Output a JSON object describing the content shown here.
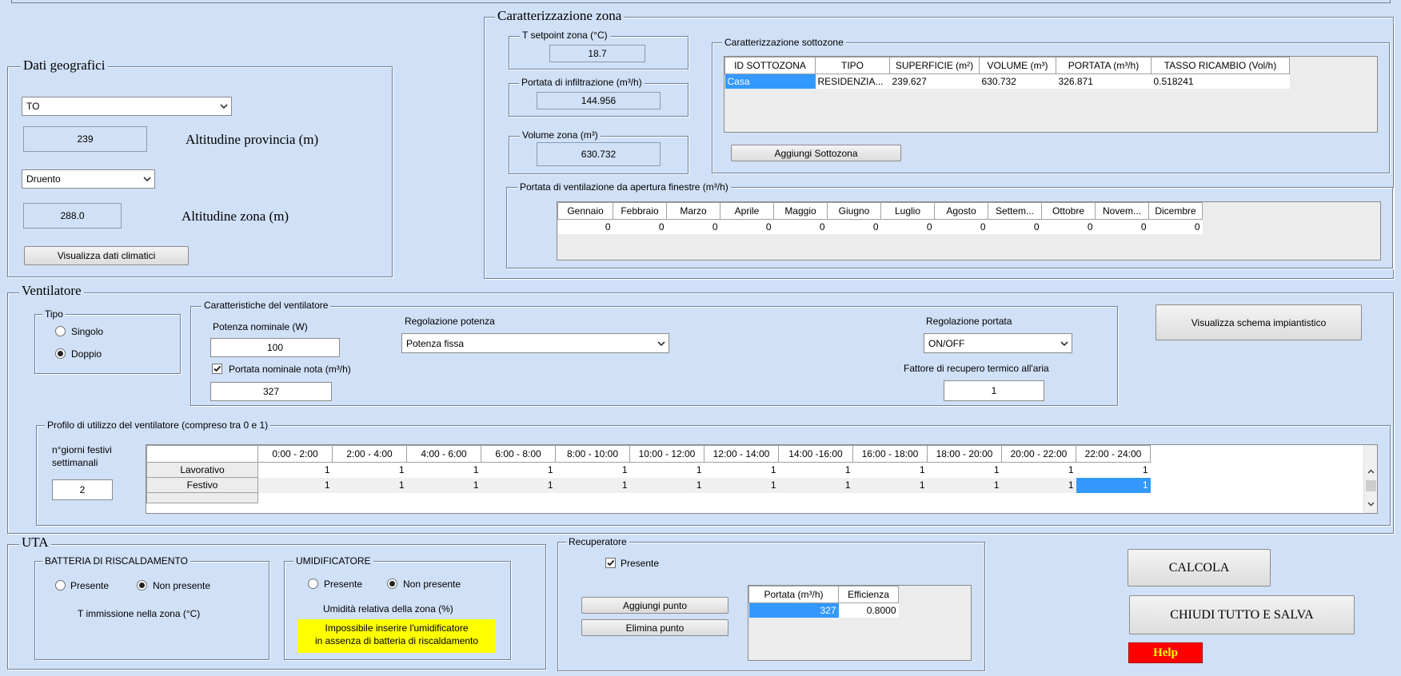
{
  "geo": {
    "title": "Dati geografici",
    "province": "TO",
    "alt_province": "239",
    "alt_province_label": "Altitudine provincia (m)",
    "comune": "Druento",
    "alt_zone": "288.0",
    "alt_zone_label": "Altitudine zona (m)",
    "climate_button": "Visualizza dati climatici"
  },
  "zona": {
    "title": "Caratterizzazione zona",
    "setpoint_title": "T setpoint zona (°C)",
    "setpoint": "18.7",
    "infil_title": "Portata di infiltrazione (m³/h)",
    "infil": "144.956",
    "vol_title": "Volume zona (m³)",
    "vol": "630.732"
  },
  "sottozone": {
    "title": "Caratterizzazione sottozone",
    "headers": [
      "ID SOTTOZONA",
      "TIPO",
      "SUPERFICIE (m²)",
      "VOLUME (m³)",
      "PORTATA (m³/h)",
      "TASSO RICAMBIO (Vol/h)"
    ],
    "row": [
      "Casa",
      "RESIDENZIA...",
      "239.627",
      "630.732",
      "326.871",
      "0.518241"
    ],
    "add_button": "Aggiungi Sottozona"
  },
  "finestre": {
    "title": "Portata di ventilazione da apertura finestre (m³/h)",
    "months": [
      "Gennaio",
      "Febbraio",
      "Marzo",
      "Aprile",
      "Maggio",
      "Giugno",
      "Luglio",
      "Agosto",
      "Settem...",
      "Ottobre",
      "Novem...",
      "Dicembre"
    ],
    "values": [
      "0",
      "0",
      "0",
      "0",
      "0",
      "0",
      "0",
      "0",
      "0",
      "0",
      "0",
      "0"
    ]
  },
  "ventilatore": {
    "title": "Ventilatore",
    "tipo_title": "Tipo",
    "singolo": "Singolo",
    "doppio": "Doppio",
    "caratt_title": "Caratteristiche del ventilatore",
    "potenza_label": "Potenza nominale (W)",
    "potenza": "100",
    "portata_chk_label": "Portata nominale nota  (m³/h)",
    "portata": "327",
    "reg_pot_label": "Regolazione potenza",
    "reg_pot": "Potenza fissa",
    "reg_port_label": "Regolazione portata",
    "reg_port": "ON/OFF",
    "recupero_label": "Fattore di recupero termico all'aria",
    "recupero": "1",
    "schema_button": "Visualizza schema impiantistico"
  },
  "profilo": {
    "title": "Profilo di utilizzo del ventilatore (compreso tra 0 e 1)",
    "festivi_label_1": "n°giorni festivi",
    "festivi_label_2": "settimanali",
    "festivi": "2",
    "headers": [
      "0:00 - 2:00",
      "2:00 - 4:00",
      "4:00 - 6:00",
      "6:00 - 8:00",
      "8:00 - 10:00",
      "10:00 - 12:00",
      "12:00 - 14:00",
      "14:00 -16:00",
      "16:00 - 18:00",
      "18:00 - 20:00",
      "20:00 - 22:00",
      "22:00 - 24:00"
    ],
    "rows": [
      {
        "label": "Lavorativo",
        "values": [
          "1",
          "1",
          "1",
          "1",
          "1",
          "1",
          "1",
          "1",
          "1",
          "1",
          "1",
          "1"
        ]
      },
      {
        "label": "Festivo",
        "values": [
          "1",
          "1",
          "1",
          "1",
          "1",
          "1",
          "1",
          "1",
          "1",
          "1",
          "1",
          "1"
        ]
      }
    ]
  },
  "uta": {
    "title": "UTA",
    "batteria_title": "BATTERIA DI RISCALDAMENTO",
    "presente": "Presente",
    "non_presente": "Non presente",
    "t_immissione": "T immissione nella zona (°C)",
    "umid_title": "UMIDIFICATORE",
    "umid_label": "Umidità relativa della zona (%)",
    "warning_1": "Impossibile inserire l'umidificatore",
    "warning_2": "in assenza di batteria di riscaldamento"
  },
  "recuperatore": {
    "title": "Recuperatore",
    "presente": "Presente",
    "add_button": "Aggiungi punto",
    "del_button": "Elimina punto",
    "headers": [
      "Portata  (m³/h)",
      "Efficienza"
    ],
    "row": [
      "327",
      "0.8000"
    ]
  },
  "actions": {
    "calcola": "CALCOLA",
    "chiudi": "CHIUDI TUTTO E SALVA",
    "help": "Help"
  }
}
